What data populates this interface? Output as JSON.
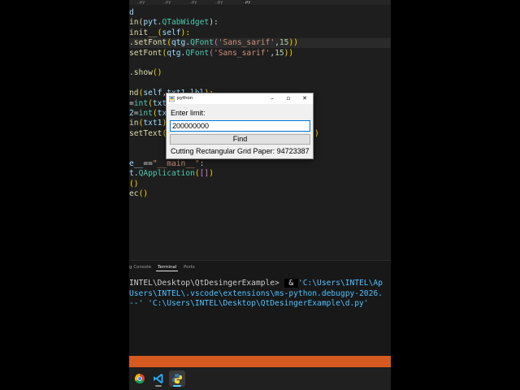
{
  "editor_tabs": [
    "..py",
    "..py",
    "..py",
    "..py",
    "..py"
  ],
  "code_lines": [
    {
      "segments": [
        {
          "t": "d",
          "c": "var"
        }
      ]
    },
    {
      "segments": [
        {
          "t": "in(",
          "c": "fn"
        },
        {
          "t": "pyt",
          "c": "var"
        },
        {
          "t": ".",
          "c": ""
        },
        {
          "t": "QTabWidget",
          "c": "cls"
        },
        {
          "t": "):",
          "c": ""
        }
      ]
    },
    {
      "segments": [
        {
          "t": "init__",
          "c": "fn"
        },
        {
          "t": "(",
          "c": "pn"
        },
        {
          "t": "self",
          "c": "var"
        },
        {
          "t": "):",
          "c": "pn"
        }
      ]
    },
    {
      "hl": true,
      "segments": [
        {
          "t": ".",
          "c": ""
        },
        {
          "t": "setFont",
          "c": "fn"
        },
        {
          "t": "(",
          "c": "pn"
        },
        {
          "t": "qtg",
          "c": "var"
        },
        {
          "t": ".",
          "c": ""
        },
        {
          "t": "QFont",
          "c": "cls"
        },
        {
          "t": "(",
          "c": "kw"
        },
        {
          "t": "'Sans_sarif'",
          "c": "str"
        },
        {
          "t": ",",
          "c": ""
        },
        {
          "t": "15",
          "c": "num"
        },
        {
          "t": "))",
          "c": "pn"
        }
      ]
    },
    {
      "segments": [
        {
          "t": "setFont",
          "c": "fn"
        },
        {
          "t": "(",
          "c": "pn"
        },
        {
          "t": "qtg",
          "c": "var"
        },
        {
          "t": ".",
          "c": ""
        },
        {
          "t": "QFont",
          "c": "cls"
        },
        {
          "t": "(",
          "c": "kw"
        },
        {
          "t": "'Sans_sarif'",
          "c": "str"
        },
        {
          "t": ",",
          "c": ""
        },
        {
          "t": "15",
          "c": "num"
        },
        {
          "t": "))",
          "c": "pn"
        }
      ]
    },
    {
      "segments": []
    },
    {
      "segments": [
        {
          "t": ".",
          "c": ""
        },
        {
          "t": "show",
          "c": "fn"
        },
        {
          "t": "()",
          "c": "pn"
        }
      ]
    },
    {
      "segments": []
    },
    {
      "segments": [
        {
          "t": "nd",
          "c": "fn"
        },
        {
          "t": "(",
          "c": "pn"
        },
        {
          "t": "self",
          "c": "var"
        },
        {
          "t": ",",
          "c": ""
        },
        {
          "t": "txt1",
          "c": "var"
        },
        {
          "t": ",",
          "c": ""
        },
        {
          "t": "lbl",
          "c": "var"
        },
        {
          "t": "):",
          "c": "pn"
        }
      ]
    },
    {
      "segments": [
        {
          "t": "=",
          "c": ""
        },
        {
          "t": "int",
          "c": "cls"
        },
        {
          "t": "(",
          "c": "pn"
        },
        {
          "t": "txt1",
          "c": "var"
        }
      ]
    },
    {
      "segments": [
        {
          "t": "2",
          "c": "var"
        },
        {
          "t": "=",
          "c": ""
        },
        {
          "t": "int",
          "c": "cls"
        },
        {
          "t": "(",
          "c": "pn"
        },
        {
          "t": "txt",
          "c": "var"
        }
      ]
    },
    {
      "segments": [
        {
          "t": "in",
          "c": "fn"
        },
        {
          "t": "(",
          "c": "pn"
        },
        {
          "t": "txt1",
          "c": "var"
        },
        {
          "t": ")",
          "c": "pn"
        }
      ]
    },
    {
      "segments": [
        {
          "t": "setText",
          "c": "fn"
        },
        {
          "t": "(",
          "c": "pn"
        },
        {
          "t": "f",
          "c": "str"
        }
      ]
    },
    {
      "segments": []
    },
    {
      "segments": []
    },
    {
      "segments": [
        {
          "t": "e__",
          "c": "var"
        },
        {
          "t": "==",
          "c": ""
        },
        {
          "t": "\"__main__\"",
          "c": "str"
        },
        {
          "t": ":",
          "c": ""
        }
      ]
    },
    {
      "segments": [
        {
          "t": "t",
          "c": "var"
        },
        {
          "t": ".",
          "c": ""
        },
        {
          "t": "QApplication",
          "c": "cls"
        },
        {
          "t": "(",
          "c": "pn"
        },
        {
          "t": "[]",
          "c": "kw"
        },
        {
          "t": ")",
          "c": "pn"
        }
      ]
    },
    {
      "segments": [
        {
          "t": "()",
          "c": "pn"
        }
      ]
    },
    {
      "segments": [
        {
          "t": "ec",
          "c": "fn"
        },
        {
          "t": "()",
          "c": "pn"
        }
      ]
    }
  ],
  "qt_window": {
    "title": "python",
    "minimize": "–",
    "maximize": "▫",
    "close": "✕",
    "label": "Enter limit:",
    "input_value": "200000000",
    "button_label": "Find",
    "result": "Cutting Rectangular Grid Paper: 94723387"
  },
  "panel": {
    "tabs": [
      "g Console",
      "Terminal",
      "Ports"
    ],
    "active_tab": "Terminal"
  },
  "terminal_lines": [
    {
      "prefix": "INTEL\\Desktop\\QtDesingerExample> ",
      "hl": " & ",
      "str": "'C:\\Users\\INTEL\\Ap"
    },
    {
      "prefix": "",
      "hl": "",
      "str": "Users\\INTEL\\.vscode\\extensions\\ms-python.debugpy-2026."
    },
    {
      "prefix": "",
      "hl": "",
      "str": "--' 'C:\\Users\\INTEL\\Desktop\\QtDesingerExample\\d.py'"
    }
  ],
  "taskbar": {
    "icons": [
      "chrome-icon",
      "vscode-icon",
      "python-icon"
    ]
  },
  "colors": {
    "statusbar": "#d65a1f",
    "editor_bg": "#1e1e1e",
    "accent": "#0078d7"
  }
}
